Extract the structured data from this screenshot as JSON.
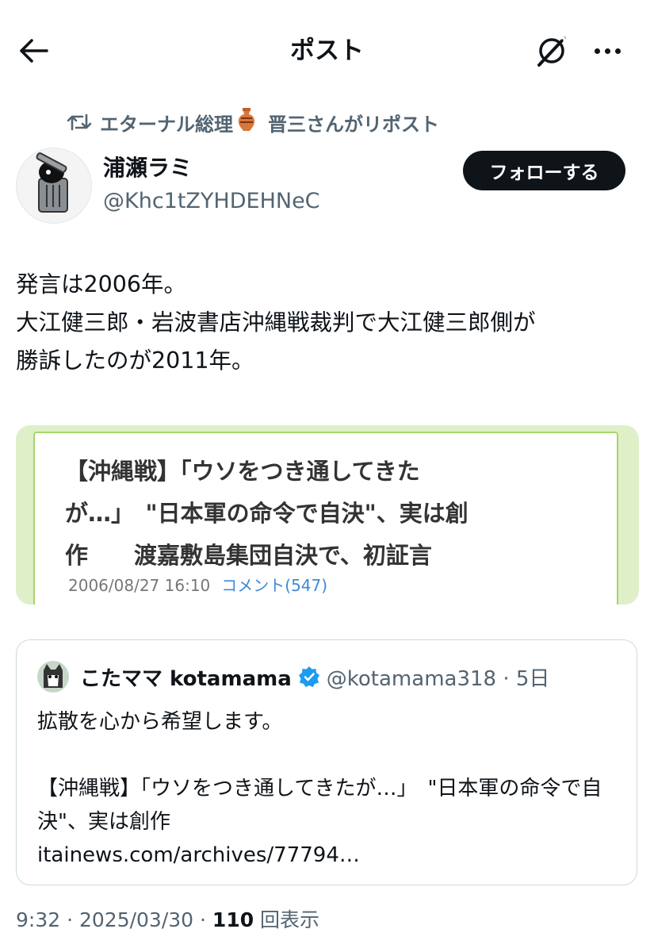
{
  "header": {
    "title": "ポスト"
  },
  "repost": {
    "text_before": "エターナル総理",
    "text_after": "晋三さんがリポスト"
  },
  "author": {
    "name": "浦瀬ラミ",
    "handle": "@Khc1tZYHDEHNeC",
    "follow_label": "フォローする"
  },
  "post": {
    "text": "発言は2006年。\n大江健三郎・岩波書店沖縄戦裁判で大江健三郎側が\n勝訴したのが2011年。"
  },
  "image": {
    "headline": "【沖縄戦】「ウソをつき通してきた\nが…」　\"日本軍の命令で自決\"、実は創\n作　　渡嘉敷島集団自決で、初証言",
    "datetime": "2006/08/27 16:10",
    "comments": "コメント(547)"
  },
  "quote": {
    "name": "こたママ kotamama",
    "handle": "@kotamama318 · 5日",
    "text": "拡散を心から希望します。\n\n【沖縄戦】「ウソをつき通してきたが…」　\"日本軍の命令で自決\"、実は創作\nitainews.com/archives/77794…"
  },
  "footer": {
    "time": "9:32 · 2025/03/30 · ",
    "views": "110",
    "views_label": " 回表示"
  },
  "colors": {
    "accent": "#0f1419",
    "secondary_text": "#536471",
    "verified": "#1d9bf0",
    "image_border": "#a6d46c"
  }
}
